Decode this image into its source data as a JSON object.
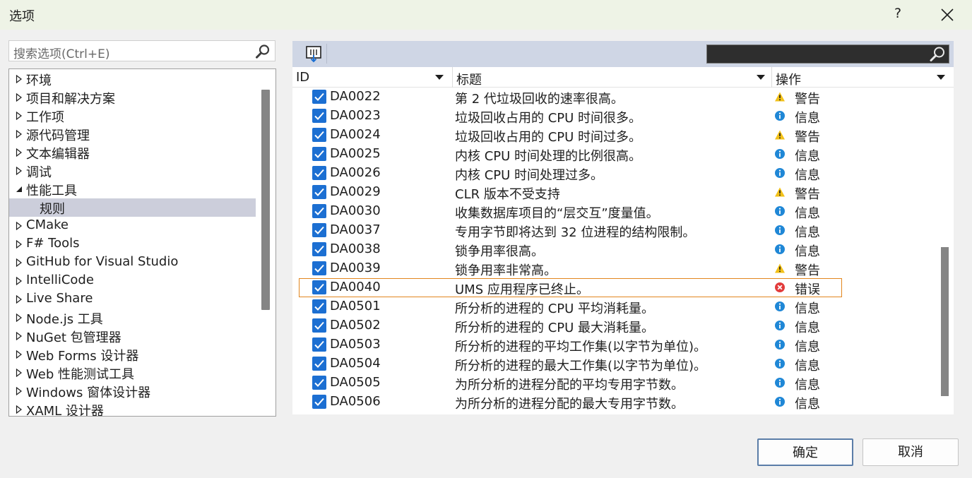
{
  "window": {
    "title": "选项",
    "help_label": "?"
  },
  "search": {
    "placeholder": "搜索选项(Ctrl+E)"
  },
  "tree": [
    {
      "label": "环境",
      "state": "collapsed"
    },
    {
      "label": "项目和解决方案",
      "state": "collapsed"
    },
    {
      "label": "工作项",
      "state": "collapsed"
    },
    {
      "label": "源代码管理",
      "state": "collapsed"
    },
    {
      "label": "文本编辑器",
      "state": "collapsed"
    },
    {
      "label": "调试",
      "state": "collapsed"
    },
    {
      "label": "性能工具",
      "state": "expanded"
    },
    {
      "label": "规则",
      "state": "child-selected"
    },
    {
      "label": "CMake",
      "state": "collapsed"
    },
    {
      "label": "F# Tools",
      "state": "collapsed"
    },
    {
      "label": "GitHub for Visual Studio",
      "state": "collapsed"
    },
    {
      "label": "IntelliCode",
      "state": "collapsed"
    },
    {
      "label": "Live Share",
      "state": "collapsed"
    },
    {
      "label": "Node.js 工具",
      "state": "collapsed"
    },
    {
      "label": "NuGet 包管理器",
      "state": "collapsed"
    },
    {
      "label": "Web Forms 设计器",
      "state": "collapsed"
    },
    {
      "label": "Web 性能测试工具",
      "state": "collapsed"
    },
    {
      "label": "Windows 窗体设计器",
      "state": "collapsed"
    },
    {
      "label": "XAML 设计器",
      "state": "collapsed"
    }
  ],
  "grid": {
    "columns": {
      "id": "ID",
      "title": "标题",
      "action": "操作"
    },
    "rows": [
      {
        "id": "DA0022",
        "title": "第 2 代垃圾回收的速率很高。",
        "action": "警告",
        "icon": "warning-icon",
        "checked": true
      },
      {
        "id": "DA0023",
        "title": "垃圾回收占用的 CPU 时间很多。",
        "action": "信息",
        "icon": "info-icon",
        "checked": true
      },
      {
        "id": "DA0024",
        "title": "垃圾回收占用的 CPU 时间过多。",
        "action": "警告",
        "icon": "warning-icon",
        "checked": true
      },
      {
        "id": "DA0025",
        "title": "内核 CPU 时间处理的比例很高。",
        "action": "信息",
        "icon": "info-icon",
        "checked": true
      },
      {
        "id": "DA0026",
        "title": "内核 CPU 时间处理过多。",
        "action": "信息",
        "icon": "info-icon",
        "checked": true
      },
      {
        "id": "DA0029",
        "title": "CLR 版本不受支持",
        "action": "警告",
        "icon": "warning-icon",
        "checked": true
      },
      {
        "id": "DA0030",
        "title": "收集数据库项目的“层交互”度量值。",
        "action": "信息",
        "icon": "info-icon",
        "checked": true
      },
      {
        "id": "DA0037",
        "title": "专用字节即将达到 32 位进程的结构限制。",
        "action": "信息",
        "icon": "info-icon",
        "checked": true
      },
      {
        "id": "DA0038",
        "title": "锁争用率很高。",
        "action": "信息",
        "icon": "info-icon",
        "checked": true
      },
      {
        "id": "DA0039",
        "title": "锁争用率非常高。",
        "action": "警告",
        "icon": "warning-icon",
        "checked": true
      },
      {
        "id": "DA0040",
        "title": "UMS 应用程序已终止。",
        "action": "错误",
        "icon": "error-icon",
        "checked": true,
        "selected": true
      },
      {
        "id": "DA0501",
        "title": "所分析的进程的 CPU 平均消耗量。",
        "action": "信息",
        "icon": "info-icon",
        "checked": true
      },
      {
        "id": "DA0502",
        "title": "所分析的进程的 CPU 最大消耗量。",
        "action": "信息",
        "icon": "info-icon",
        "checked": true
      },
      {
        "id": "DA0503",
        "title": "所分析的进程的平均工作集(以字节为单位)。",
        "action": "信息",
        "icon": "info-icon",
        "checked": true
      },
      {
        "id": "DA0504",
        "title": "所分析的进程的最大工作集(以字节为单位)。",
        "action": "信息",
        "icon": "info-icon",
        "checked": true
      },
      {
        "id": "DA0505",
        "title": "为所分析的进程分配的平均专用字节数。",
        "action": "信息",
        "icon": "info-icon",
        "checked": true
      },
      {
        "id": "DA0506",
        "title": "为所分析的进程分配的最大专用字节数。",
        "action": "信息",
        "icon": "info-icon",
        "checked": true
      }
    ]
  },
  "buttons": {
    "ok": "确定",
    "cancel": "取消"
  },
  "colors": {
    "checkbox": "#1c6fd2",
    "selection_outline": "#e2861e",
    "tree_selected": "#cccedb",
    "toolbar": "#cfd6e5",
    "titlebar": "#eef3e6"
  }
}
